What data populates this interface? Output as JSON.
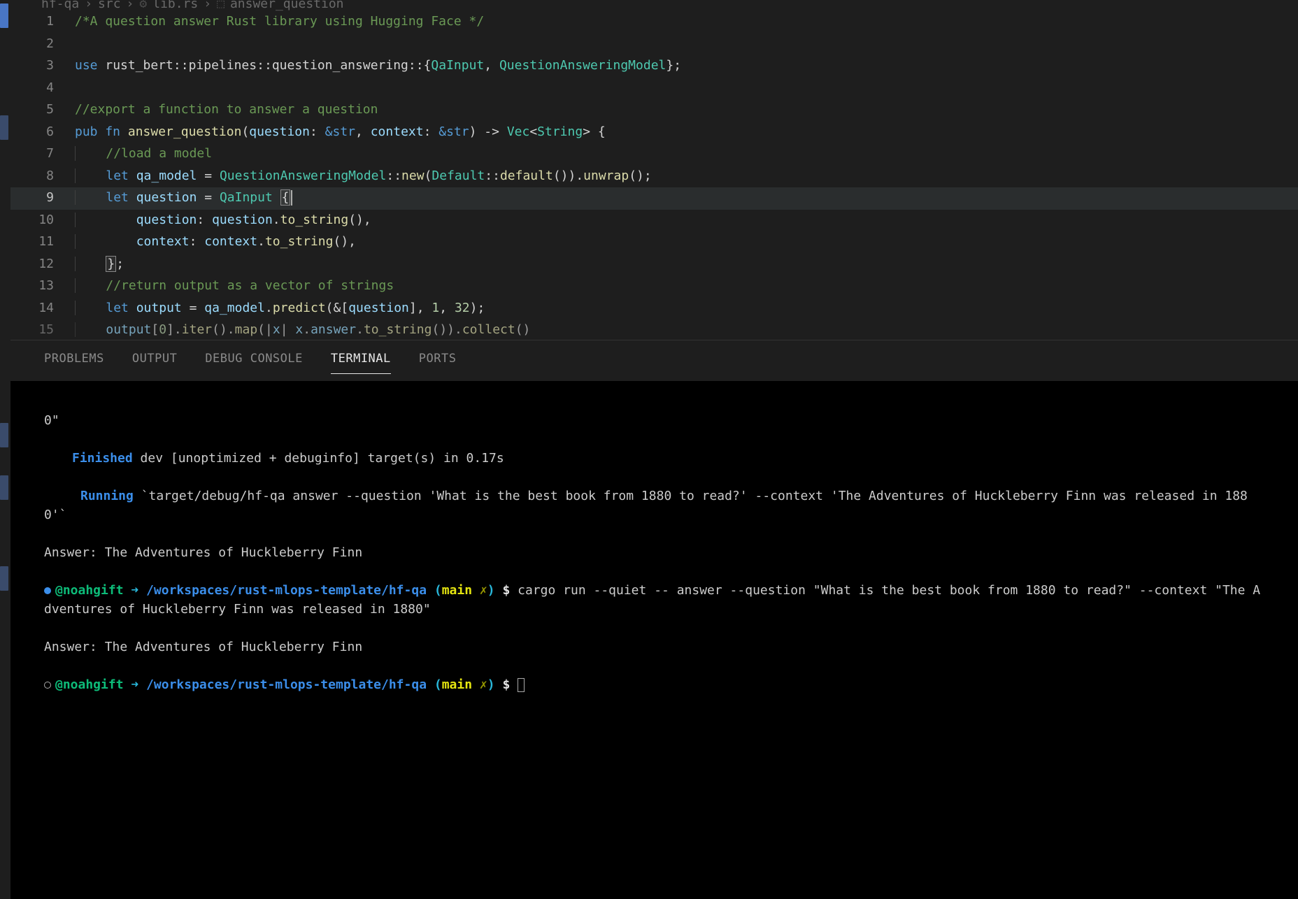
{
  "breadcrumb": {
    "folder": "hf-qa",
    "subfolder": "src",
    "file": "lib.rs",
    "symbol": "answer_question"
  },
  "editor": {
    "lines": [
      {
        "num": "1",
        "tokens": [
          {
            "cls": "c-comment",
            "text": "/*A question answer Rust library using Hugging Face */"
          }
        ]
      },
      {
        "num": "2",
        "tokens": []
      },
      {
        "num": "3",
        "tokens": [
          {
            "cls": "c-use",
            "text": "use"
          },
          {
            "cls": "c-punct",
            "text": " rust_bert"
          },
          {
            "cls": "c-punct",
            "text": "::"
          },
          {
            "cls": "c-punct",
            "text": "pipelines"
          },
          {
            "cls": "c-punct",
            "text": "::"
          },
          {
            "cls": "c-punct",
            "text": "question_answering"
          },
          {
            "cls": "c-punct",
            "text": "::{"
          },
          {
            "cls": "c-type",
            "text": "QaInput"
          },
          {
            "cls": "c-punct",
            "text": ", "
          },
          {
            "cls": "c-type",
            "text": "QuestionAnsweringModel"
          },
          {
            "cls": "c-punct",
            "text": "};"
          }
        ]
      },
      {
        "num": "4",
        "tokens": []
      },
      {
        "num": "5",
        "tokens": [
          {
            "cls": "c-comment",
            "text": "//export a function to answer a question"
          }
        ]
      },
      {
        "num": "6",
        "tokens": [
          {
            "cls": "c-keyword",
            "text": "pub fn"
          },
          {
            "cls": "c-punct",
            "text": " "
          },
          {
            "cls": "c-fn",
            "text": "answer_question"
          },
          {
            "cls": "c-punct",
            "text": "("
          },
          {
            "cls": "c-var",
            "text": "question"
          },
          {
            "cls": "c-punct",
            "text": ": "
          },
          {
            "cls": "c-keyword",
            "text": "&str"
          },
          {
            "cls": "c-punct",
            "text": ", "
          },
          {
            "cls": "c-var",
            "text": "context"
          },
          {
            "cls": "c-punct",
            "text": ": "
          },
          {
            "cls": "c-keyword",
            "text": "&str"
          },
          {
            "cls": "c-punct",
            "text": ") -> "
          },
          {
            "cls": "c-type",
            "text": "Vec"
          },
          {
            "cls": "c-punct",
            "text": "<"
          },
          {
            "cls": "c-type",
            "text": "String"
          },
          {
            "cls": "c-punct",
            "text": "> {"
          }
        ]
      },
      {
        "num": "7",
        "indent": 1,
        "tokens": [
          {
            "cls": "c-comment",
            "text": "//load a model"
          }
        ]
      },
      {
        "num": "8",
        "indent": 1,
        "tokens": [
          {
            "cls": "c-let",
            "text": "let"
          },
          {
            "cls": "c-punct",
            "text": " "
          },
          {
            "cls": "c-var",
            "text": "qa_model"
          },
          {
            "cls": "c-punct",
            "text": " = "
          },
          {
            "cls": "c-type",
            "text": "QuestionAnsweringModel"
          },
          {
            "cls": "c-punct",
            "text": "::"
          },
          {
            "cls": "c-method",
            "text": "new"
          },
          {
            "cls": "c-punct",
            "text": "("
          },
          {
            "cls": "c-type",
            "text": "Default"
          },
          {
            "cls": "c-punct",
            "text": "::"
          },
          {
            "cls": "c-method",
            "text": "default"
          },
          {
            "cls": "c-punct",
            "text": "())."
          },
          {
            "cls": "c-method",
            "text": "unwrap"
          },
          {
            "cls": "c-punct",
            "text": "();"
          }
        ]
      },
      {
        "num": "9",
        "indent": 1,
        "current": true,
        "tokens": [
          {
            "cls": "c-let",
            "text": "let"
          },
          {
            "cls": "c-punct",
            "text": " "
          },
          {
            "cls": "c-var",
            "text": "question"
          },
          {
            "cls": "c-punct",
            "text": " = "
          },
          {
            "cls": "c-type",
            "text": "QaInput"
          },
          {
            "cls": "c-punct",
            "text": " "
          },
          {
            "cls": "bracket-match",
            "text": "{"
          }
        ]
      },
      {
        "num": "10",
        "indent": 2,
        "tokens": [
          {
            "cls": "c-var",
            "text": "question"
          },
          {
            "cls": "c-punct",
            "text": ": "
          },
          {
            "cls": "c-var",
            "text": "question"
          },
          {
            "cls": "c-punct",
            "text": "."
          },
          {
            "cls": "c-method",
            "text": "to_string"
          },
          {
            "cls": "c-punct",
            "text": "(),"
          }
        ]
      },
      {
        "num": "11",
        "indent": 2,
        "tokens": [
          {
            "cls": "c-var",
            "text": "context"
          },
          {
            "cls": "c-punct",
            "text": ": "
          },
          {
            "cls": "c-var",
            "text": "context"
          },
          {
            "cls": "c-punct",
            "text": "."
          },
          {
            "cls": "c-method",
            "text": "to_string"
          },
          {
            "cls": "c-punct",
            "text": "(),"
          }
        ]
      },
      {
        "num": "12",
        "indent": 1,
        "tokens": [
          {
            "cls": "bracket-match",
            "text": "}"
          },
          {
            "cls": "c-punct",
            "text": ";"
          }
        ]
      },
      {
        "num": "13",
        "indent": 1,
        "tokens": [
          {
            "cls": "c-comment",
            "text": "//return output as a vector of strings"
          }
        ]
      },
      {
        "num": "14",
        "indent": 1,
        "tokens": [
          {
            "cls": "c-let",
            "text": "let"
          },
          {
            "cls": "c-punct",
            "text": " "
          },
          {
            "cls": "c-var",
            "text": "output"
          },
          {
            "cls": "c-punct",
            "text": " = "
          },
          {
            "cls": "c-var",
            "text": "qa_model"
          },
          {
            "cls": "c-punct",
            "text": "."
          },
          {
            "cls": "c-method",
            "text": "predict"
          },
          {
            "cls": "c-punct",
            "text": "(&["
          },
          {
            "cls": "c-var",
            "text": "question"
          },
          {
            "cls": "c-punct",
            "text": "], "
          },
          {
            "cls": "c-number",
            "text": "1"
          },
          {
            "cls": "c-punct",
            "text": ", "
          },
          {
            "cls": "c-number",
            "text": "32"
          },
          {
            "cls": "c-punct",
            "text": ");"
          }
        ]
      },
      {
        "num": "15",
        "indent": 1,
        "last": true,
        "tokens": [
          {
            "cls": "c-var",
            "text": "output"
          },
          {
            "cls": "c-punct",
            "text": "["
          },
          {
            "cls": "c-number",
            "text": "0"
          },
          {
            "cls": "c-punct",
            "text": "]."
          },
          {
            "cls": "c-method",
            "text": "iter"
          },
          {
            "cls": "c-punct",
            "text": "()."
          },
          {
            "cls": "c-method",
            "text": "map"
          },
          {
            "cls": "c-punct",
            "text": "(|"
          },
          {
            "cls": "c-var",
            "text": "x"
          },
          {
            "cls": "c-punct",
            "text": "| "
          },
          {
            "cls": "c-var",
            "text": "x"
          },
          {
            "cls": "c-punct",
            "text": "."
          },
          {
            "cls": "c-var",
            "text": "answer"
          },
          {
            "cls": "c-punct",
            "text": "."
          },
          {
            "cls": "c-method",
            "text": "to_string"
          },
          {
            "cls": "c-punct",
            "text": "())."
          },
          {
            "cls": "c-method",
            "text": "collect"
          },
          {
            "cls": "c-punct",
            "text": "()"
          }
        ]
      }
    ]
  },
  "panel": {
    "tabs": [
      "PROBLEMS",
      "OUTPUT",
      "DEBUG CONSOLE",
      "TERMINAL",
      "PORTS"
    ],
    "active_tab": "TERMINAL"
  },
  "terminal": {
    "line0": "0\"",
    "finished_label": "Finished",
    "finished_rest": " dev [unoptimized + debuginfo] target(s) in 0.17s",
    "running_label": "Running",
    "running_rest": " `target/debug/hf-qa answer --question 'What is the best book from 1880 to read?' --context 'The Adventures of Huckleberry Finn was released in 1880'`",
    "answer1": "Answer: The Adventures of Huckleberry Finn",
    "user": "@noahgift",
    "arrow": " ➜ ",
    "cwd": "/workspaces/rust-mlops-template/hf-qa",
    "branch_open": " (",
    "branch_main": "main",
    "branch_x": " ✗",
    "branch_close": ")",
    "dollar": " $ ",
    "cmd1": "cargo run --quiet -- answer --question \"What is the best book from 1880 to read?\" --context \"The Adventures of Huckleberry Finn was released in 1880\"",
    "answer2": "Answer: The Adventures of Huckleberry Finn"
  }
}
